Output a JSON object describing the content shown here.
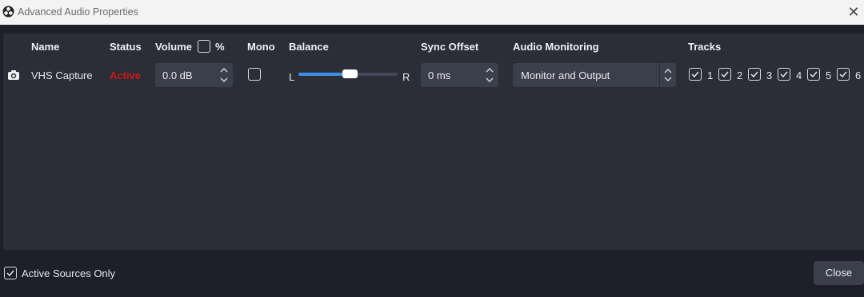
{
  "window": {
    "title": "Advanced Audio Properties"
  },
  "headers": {
    "name": "Name",
    "status": "Status",
    "volume": "Volume",
    "volume_unit": "%",
    "mono": "Mono",
    "balance": "Balance",
    "sync_offset": "Sync Offset",
    "audio_monitoring": "Audio Monitoring",
    "tracks": "Tracks"
  },
  "sources": [
    {
      "icon": "camera-icon",
      "name": "VHS Capture",
      "status": "Active",
      "status_color": "#d01818",
      "volume": "0.0 dB",
      "mono": false,
      "balance_left_label": "L",
      "balance_right_label": "R",
      "balance": 0.5,
      "sync_offset": "0 ms",
      "audio_monitoring": "Monitor and Output",
      "tracks": [
        {
          "label": "1",
          "checked": true
        },
        {
          "label": "2",
          "checked": true
        },
        {
          "label": "3",
          "checked": true
        },
        {
          "label": "4",
          "checked": true
        },
        {
          "label": "5",
          "checked": true
        },
        {
          "label": "6",
          "checked": true
        }
      ]
    }
  ],
  "footer": {
    "active_sources_only_label": "Active Sources Only",
    "active_sources_only": true,
    "close_label": "Close"
  },
  "colors": {
    "accent": "#3d8fe6",
    "background": "#1e1f28",
    "panel": "#2b2d37",
    "control": "#3b3e4b"
  }
}
